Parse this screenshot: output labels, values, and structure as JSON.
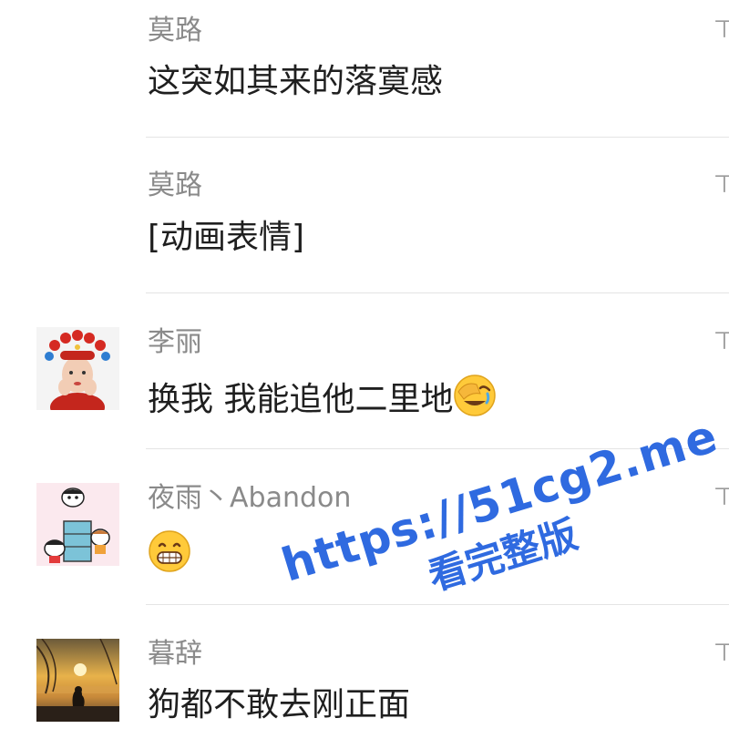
{
  "comments": [
    {
      "name": "莫路",
      "message": "这突如其来的落寞感",
      "avatar": "none"
    },
    {
      "name": "莫路",
      "message": "[动画表情]",
      "avatar": "none"
    },
    {
      "name": "李丽",
      "message": "换我  我能追他二里地",
      "emoji": "face-palm-laughing-emoji",
      "avatar": "child-opera-costume-avatar"
    },
    {
      "name": "夜雨丶Abandon",
      "message": "",
      "emoji": "grinning-teeth-emoji",
      "avatar": "cartoon-kids-avatar"
    },
    {
      "name": "暮辞",
      "message": "狗都不敢去刚正面",
      "avatar": "sunset-dog-avatar"
    }
  ],
  "watermark": {
    "url": "https://51cg2.me",
    "subtitle": "看完整版",
    "color": "#2f6ae0"
  }
}
